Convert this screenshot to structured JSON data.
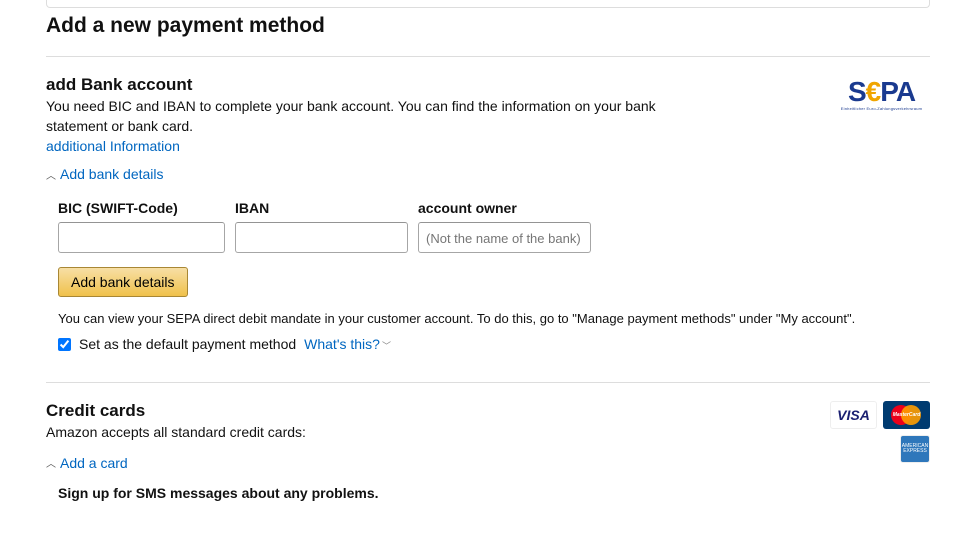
{
  "page_title": "Add a new payment method",
  "bank": {
    "section_title": "add Bank account",
    "description": "You need BIC and IBAN to complete your bank account. You can find the information on your bank statement or bank card.",
    "additional_info_link": "additional Information",
    "expand_link": "Add bank details",
    "fields": {
      "bic_label": "BIC (SWIFT-Code)",
      "iban_label": "IBAN",
      "owner_label": "account owner",
      "owner_placeholder": "(Not the name of the bank)"
    },
    "add_button": "Add bank details",
    "mandate_note": "You can view your SEPA direct debit mandate in your customer account. To do this, go to \"Manage payment methods\" under \"My account\".",
    "default_checkbox_checked": true,
    "default_label": "Set as the default payment method",
    "whats_this": "What's this?",
    "sepa_tagline": "Einheitlicher Euro-Zahlungsverkehrsraum"
  },
  "cc": {
    "section_title": "Credit cards",
    "description": "Amazon accepts all standard credit cards:",
    "expand_link": "Add a card",
    "sms_note": "Sign up for SMS messages about any problems.",
    "logos": {
      "visa": "VISA",
      "mastercard": "MasterCard",
      "amex": "AMERICAN EXPRESS"
    }
  }
}
